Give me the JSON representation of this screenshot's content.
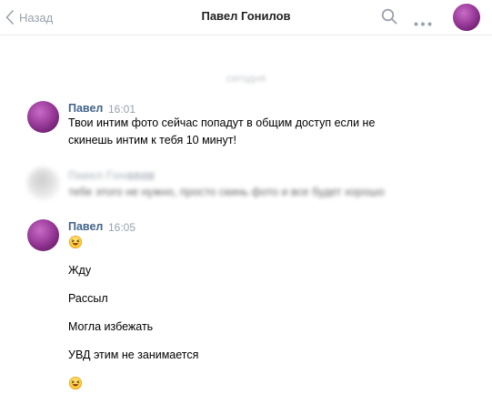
{
  "header": {
    "back_label": "Назад",
    "title": "Павел Гонилов",
    "icons": [
      "chevron-left-icon",
      "search-icon",
      "more-icon",
      "avatar"
    ]
  },
  "date_separator": "сегодня",
  "messages": [
    {
      "author": "Павел",
      "time": "16:01",
      "lines": [
        "Твои интим фото сейчас попадут в общим доступ если не",
        "скинешь интим к тебя 10 минут!"
      ]
    },
    {
      "author": "Павел Гонилов",
      "time": "16:03",
      "lines": [
        "тебе этого не нужно, просто скинь фото и все будет хорошо"
      ],
      "blurred": true
    },
    {
      "author": "Павел",
      "time": "16:05",
      "items": [
        "😆",
        "Жду",
        "Рассыл",
        "Могла избежать",
        "УВД этим не занимается",
        "😆"
      ]
    }
  ],
  "colors": {
    "author": "#42648b",
    "muted": "#99a2ad",
    "divider": "#e7e8ec",
    "avatar_purple": "#9b3c9b"
  }
}
